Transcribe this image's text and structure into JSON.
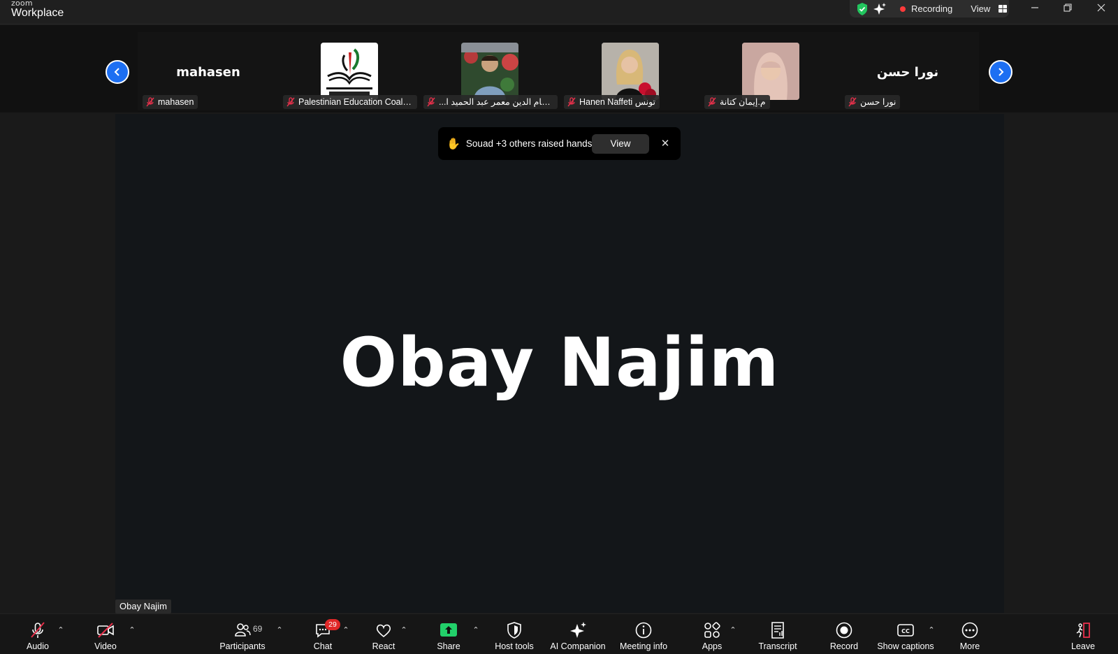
{
  "app": {
    "brand_small": "zoom",
    "brand_large": "Workplace"
  },
  "status": {
    "recording_label": "Recording",
    "view_label": "View"
  },
  "gallery": {
    "tiles": [
      {
        "display": "mahasen",
        "label": "mahasen",
        "type": "name"
      },
      {
        "display": "",
        "label": "Palestinian Education Coaliti...",
        "type": "logo"
      },
      {
        "display": "",
        "label": "...حسام الدين معمر عبد الحميد ا",
        "type": "photo"
      },
      {
        "display": "",
        "label": "Hanen Naffeti تونس",
        "type": "photo"
      },
      {
        "display": "",
        "label": "م.إيمان كتانة",
        "type": "photo"
      },
      {
        "display": "نورا حسن",
        "label": "نورا حسن",
        "type": "name"
      }
    ]
  },
  "notification": {
    "text": "Souad +3 others raised hands",
    "button": "View",
    "close": "✕"
  },
  "stage": {
    "speaker_name": "Obay Najim",
    "speaker_label": "Obay Najim"
  },
  "toolbar": {
    "audio": "Audio",
    "video": "Video",
    "participants": "Participants",
    "participants_count": "69",
    "chat": "Chat",
    "chat_badge": "29",
    "react": "React",
    "share": "Share",
    "host_tools": "Host tools",
    "ai_companion": "AI Companion",
    "meeting_info": "Meeting info",
    "apps": "Apps",
    "transcript": "Transcript",
    "record": "Record",
    "show_captions": "Show captions",
    "more": "More",
    "leave": "Leave"
  },
  "colors": {
    "accent_blue": "#1d6ff2",
    "share_green": "#22d06a",
    "leave_red": "#e8304b",
    "recording_red": "#ff3b3b"
  }
}
